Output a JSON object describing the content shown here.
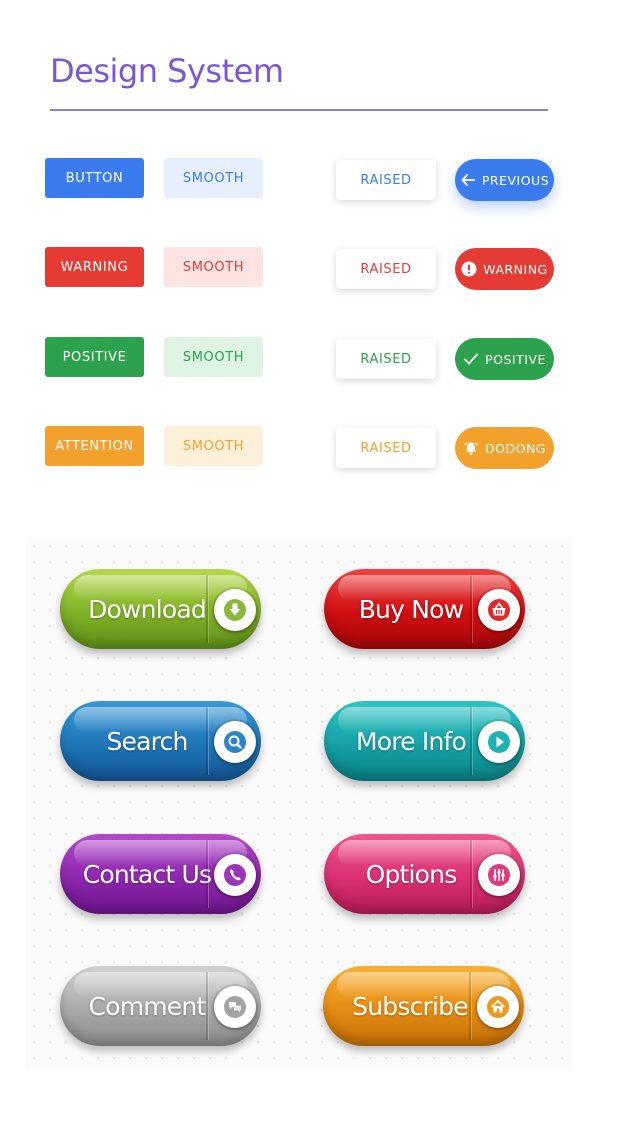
{
  "title": "Design System",
  "flat_buttons": {
    "button": "BUTTON",
    "smooth": "SMOOTH",
    "warning": "WARNING",
    "positive": "POSITIVE",
    "attention": "ATTENTION"
  },
  "raised_label": "RAISED",
  "pills": {
    "previous": "PREVIOUS",
    "warning": "WARNING",
    "positive": "POSITIVE",
    "dodong": "DODONG"
  },
  "big_buttons": {
    "download": "Download",
    "buy_now": "Buy Now",
    "search": "Search",
    "more_info": "More Info",
    "contact_us": "Contact Us",
    "options": "Options",
    "comment": "Comment",
    "subscribe": "Subscribe"
  },
  "colors": {
    "primary": "#3a7cee",
    "danger": "#e53b34",
    "success": "#2ba24b",
    "attention": "#f2a12d",
    "title": "#7a55d8"
  },
  "icons": [
    "arrow-left-icon",
    "exclamation-icon",
    "checkmark-icon",
    "bell-icon",
    "download-arrow-icon",
    "basket-icon",
    "magnifier-icon",
    "play-icon",
    "phone-icon",
    "sliders-icon",
    "chat-bubbles-icon",
    "home-icon"
  ]
}
